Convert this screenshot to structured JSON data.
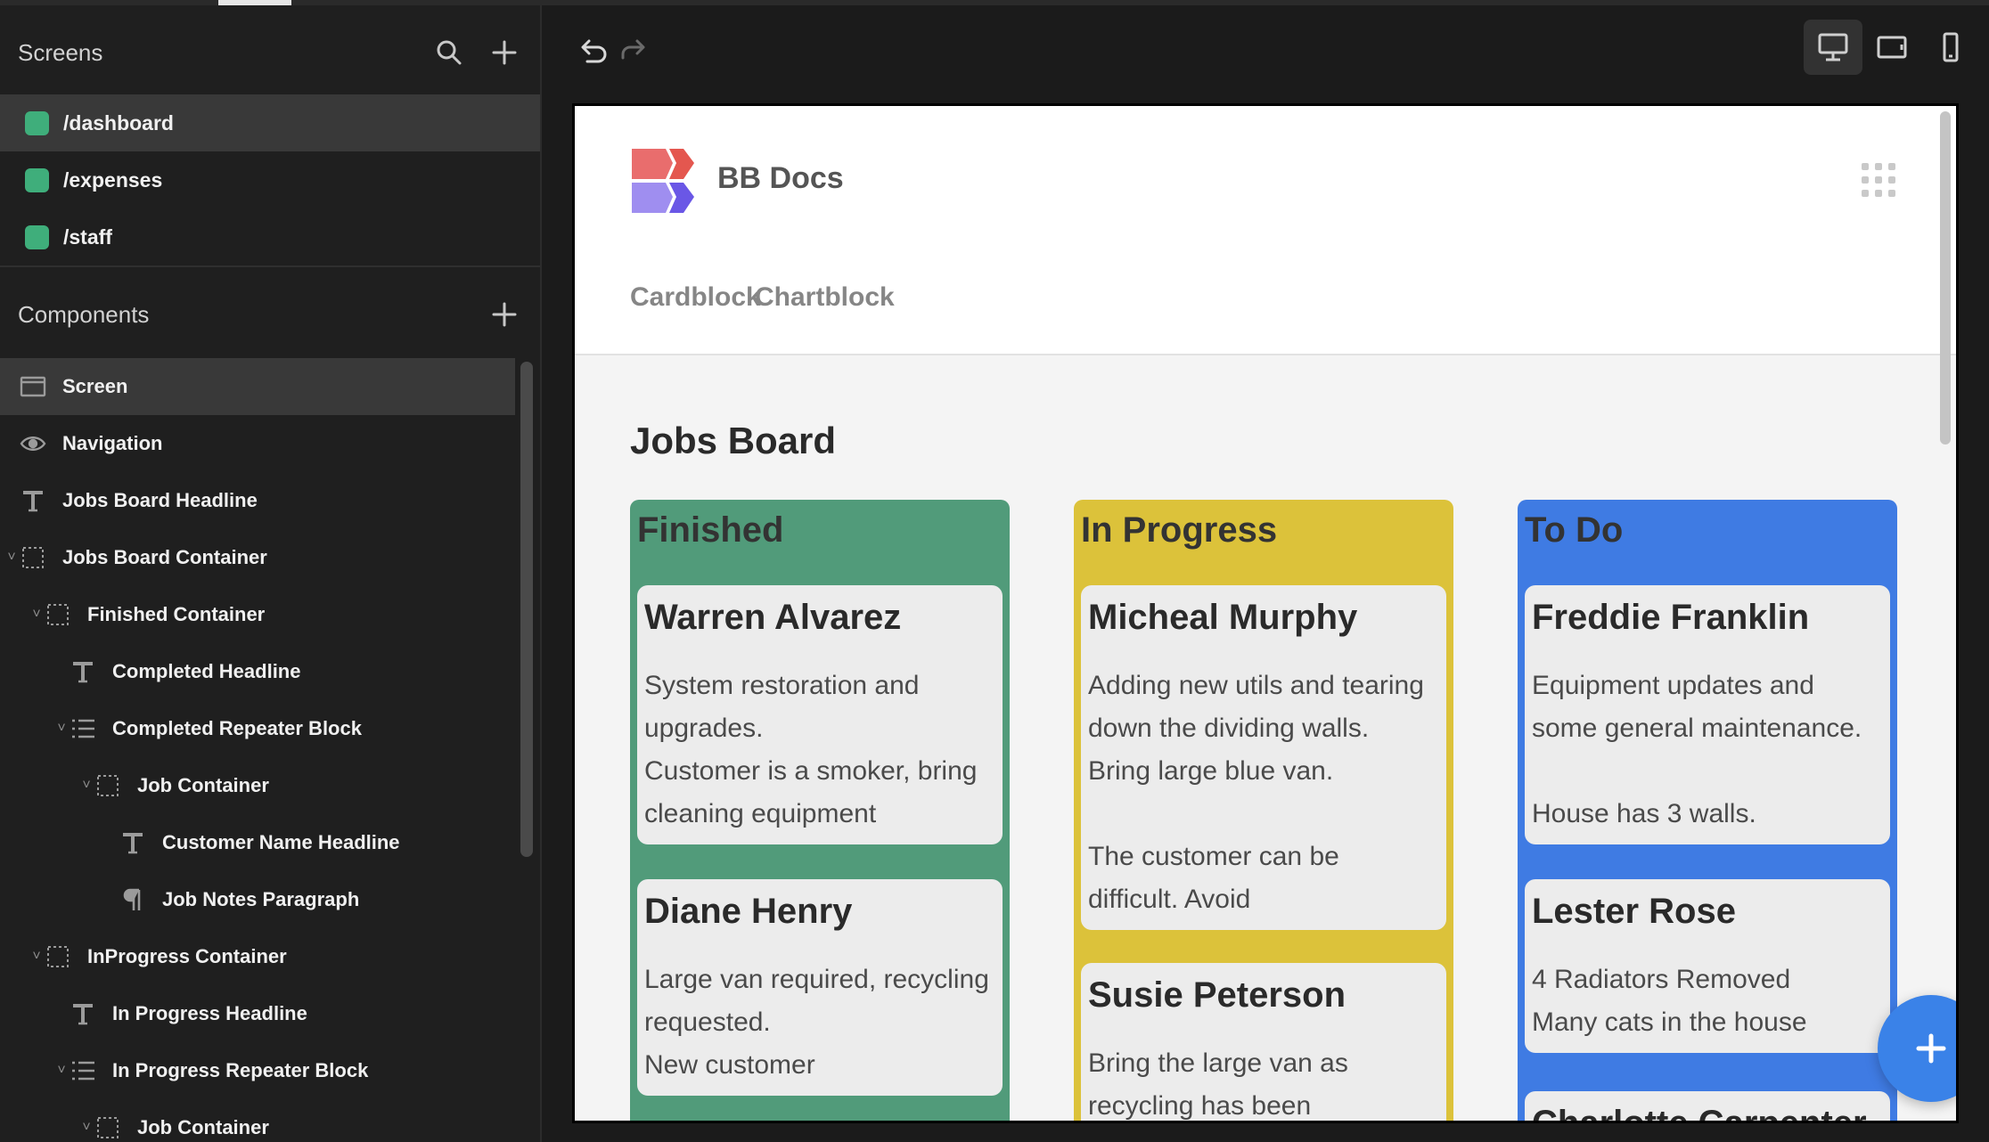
{
  "sidebar": {
    "screens_title": "Screens",
    "screens": [
      {
        "label": "/dashboard",
        "active": true
      },
      {
        "label": "/expenses",
        "active": false
      },
      {
        "label": "/staff",
        "active": false
      }
    ],
    "components_title": "Components",
    "components": [
      {
        "label": "Screen",
        "icon": "screen-icon",
        "depth": 0,
        "chevron": false,
        "active": true
      },
      {
        "label": "Navigation",
        "icon": "eye-icon",
        "depth": 0,
        "chevron": false,
        "active": false
      },
      {
        "label": "Jobs Board Headline",
        "icon": "text-icon",
        "depth": 0,
        "chevron": false,
        "active": false
      },
      {
        "label": "Jobs Board Container",
        "icon": "container-icon",
        "depth": 0,
        "chevron": true,
        "active": false
      },
      {
        "label": "Finished Container",
        "icon": "container-icon",
        "depth": 1,
        "chevron": true,
        "active": false
      },
      {
        "label": "Completed Headline",
        "icon": "text-icon",
        "depth": 2,
        "chevron": false,
        "active": false
      },
      {
        "label": "Completed Repeater Block",
        "icon": "list-icon",
        "depth": 2,
        "chevron": true,
        "active": false
      },
      {
        "label": "Job Container",
        "icon": "container-icon",
        "depth": 3,
        "chevron": true,
        "active": false
      },
      {
        "label": "Customer Name Headline",
        "icon": "text-icon",
        "depth": 4,
        "chevron": false,
        "active": false
      },
      {
        "label": "Job Notes Paragraph",
        "icon": "paragraph-icon",
        "depth": 4,
        "chevron": false,
        "active": false
      },
      {
        "label": "InProgress Container",
        "icon": "container-icon",
        "depth": 1,
        "chevron": true,
        "active": false
      },
      {
        "label": "In Progress Headline",
        "icon": "text-icon",
        "depth": 2,
        "chevron": false,
        "active": false
      },
      {
        "label": "In Progress Repeater Block",
        "icon": "list-icon",
        "depth": 2,
        "chevron": true,
        "active": false
      },
      {
        "label": "Job Container",
        "icon": "container-icon",
        "depth": 3,
        "chevron": true,
        "active": false
      }
    ]
  },
  "toolbar": {
    "undo_icon": "undo-icon",
    "redo_icon": "redo-icon",
    "devices": [
      {
        "icon": "desktop-icon",
        "active": true
      },
      {
        "icon": "tablet-icon",
        "active": false
      },
      {
        "icon": "mobile-icon",
        "active": false
      }
    ]
  },
  "preview": {
    "brand": "BB Docs",
    "nav_links": [
      "Cardblock",
      "Chartblock"
    ],
    "page_title": "Jobs Board",
    "colors": {
      "finished": "#519b7a",
      "in_progress": "#dcc23a",
      "to_do": "#3f7be3",
      "logo_red": "#e96d6d",
      "logo_purple": "#7467e8"
    },
    "columns": [
      {
        "title": "Finished",
        "cards": [
          {
            "name": "Warren Alvarez",
            "notes": "System restoration and\nupgrades.\nCustomer is a smoker, bring\ncleaning equipment"
          },
          {
            "name": "Diane Henry",
            "notes": "Large van required, recycling\nrequested.\nNew customer"
          }
        ]
      },
      {
        "title": "In Progress",
        "cards": [
          {
            "name": "Micheal Murphy",
            "notes": "Adding new utils and tearing\ndown the dividing walls.\nBring large blue van.\n\nThe customer can be\ndifficult. Avoid"
          },
          {
            "name": "Susie Peterson",
            "notes": "Bring the large van as\nrecycling has been"
          }
        ]
      },
      {
        "title": "To Do",
        "cards": [
          {
            "name": "Freddie Franklin",
            "notes": "Equipment updates and\nsome general maintenance.\n\nHouse has 3 walls."
          },
          {
            "name": "Lester Rose",
            "notes": "4 Radiators Removed\nMany cats in the house"
          },
          {
            "name": "Charlotte Carpenter",
            "notes": ""
          }
        ]
      }
    ]
  }
}
